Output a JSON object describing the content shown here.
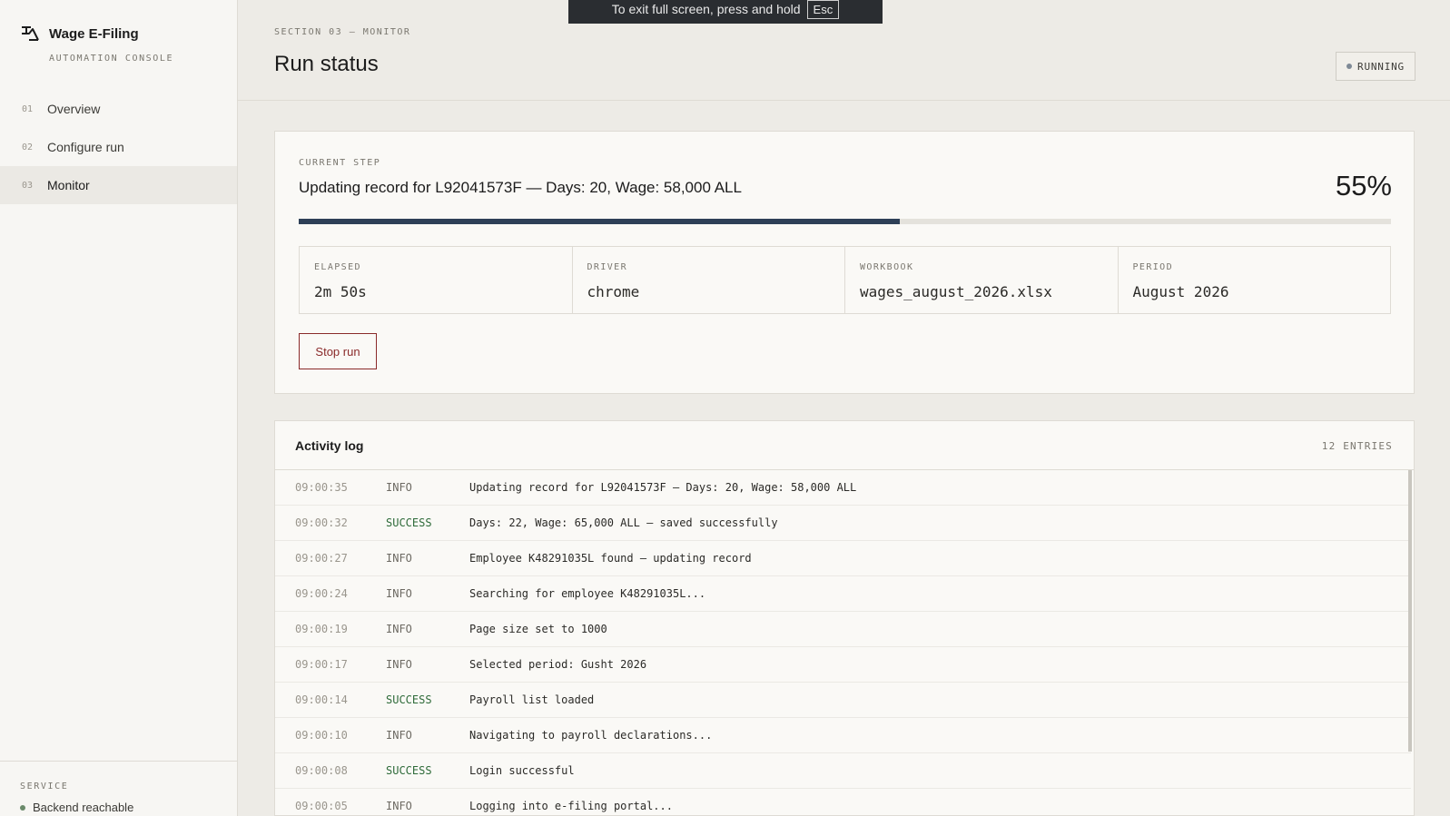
{
  "app": {
    "name": "Wage E-Filing",
    "subtitle": "AUTOMATION CONSOLE"
  },
  "nav": [
    {
      "num": "01",
      "label": "Overview"
    },
    {
      "num": "02",
      "label": "Configure run"
    },
    {
      "num": "03",
      "label": "Monitor"
    }
  ],
  "service": {
    "heading": "SERVICE",
    "status": "Backend reachable"
  },
  "header": {
    "section": "SECTION 03 — MONITOR",
    "title": "Run status",
    "badge": "RUNNING"
  },
  "fullscreen_banner": {
    "text": "To exit full screen, press and hold",
    "key": "Esc"
  },
  "current": {
    "label": "CURRENT STEP",
    "text": "Updating record for L92041573F — Days: 20, Wage: 58,000 ALL",
    "percent_label": "55%",
    "progress": 0.55
  },
  "stats": [
    {
      "label": "ELAPSED",
      "value": "2m 50s"
    },
    {
      "label": "DRIVER",
      "value": "chrome"
    },
    {
      "label": "WORKBOOK",
      "value": "wages_august_2026.xlsx"
    },
    {
      "label": "PERIOD",
      "value": "August 2026"
    }
  ],
  "stop_button": "Stop run",
  "log": {
    "title": "Activity log",
    "count": "12 ENTRIES",
    "entries": [
      {
        "time": "09:00:35",
        "level": "INFO",
        "message": "Updating record for L92041573F — Days: 20, Wage: 58,000 ALL"
      },
      {
        "time": "09:00:32",
        "level": "SUCCESS",
        "message": "Days: 22, Wage: 65,000 ALL — saved successfully"
      },
      {
        "time": "09:00:27",
        "level": "INFO",
        "message": "Employee K48291035L found — updating record"
      },
      {
        "time": "09:00:24",
        "level": "INFO",
        "message": "Searching for employee K48291035L..."
      },
      {
        "time": "09:00:19",
        "level": "INFO",
        "message": "Page size set to 1000"
      },
      {
        "time": "09:00:17",
        "level": "INFO",
        "message": "Selected period: Gusht 2026"
      },
      {
        "time": "09:00:14",
        "level": "SUCCESS",
        "message": "Payroll list loaded"
      },
      {
        "time": "09:00:10",
        "level": "INFO",
        "message": "Navigating to payroll declarations..."
      },
      {
        "time": "09:00:08",
        "level": "SUCCESS",
        "message": "Login successful"
      },
      {
        "time": "09:00:05",
        "level": "INFO",
        "message": "Logging into e-filing portal..."
      }
    ]
  }
}
